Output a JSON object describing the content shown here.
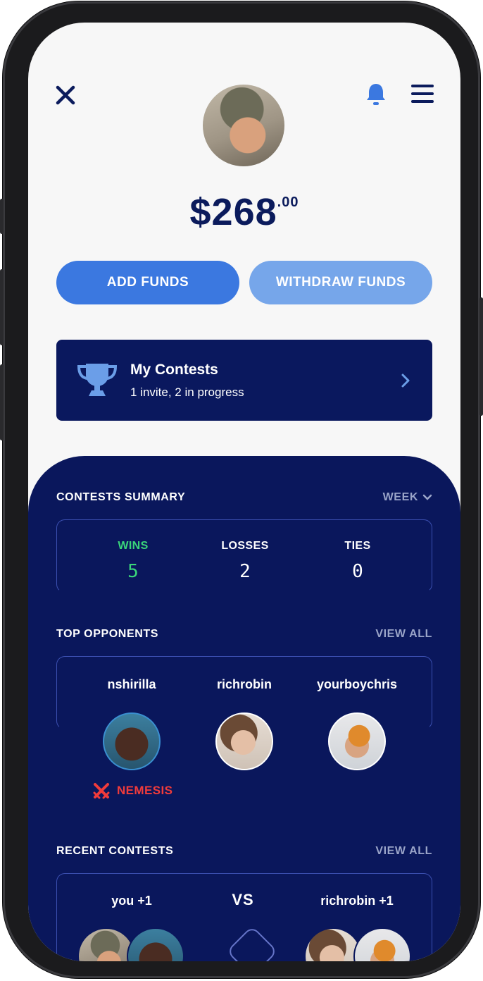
{
  "header": {
    "close_icon": "close-icon",
    "bell_icon": "bell-icon",
    "menu_icon": "hamburger-menu-icon"
  },
  "balance": {
    "dollars": "$268",
    "cents": ".00"
  },
  "actions": {
    "add_funds": "ADD FUNDS",
    "withdraw_funds": "WITHDRAW FUNDS"
  },
  "my_contests": {
    "title": "My Contests",
    "subtitle": "1 invite, 2 in progress",
    "icon": "trophy-icon"
  },
  "contests_summary": {
    "title": "CONTESTS SUMMARY",
    "period": "WEEK",
    "stats": [
      {
        "label": "WINS",
        "value": "5",
        "color": "#3ad67a"
      },
      {
        "label": "LOSSES",
        "value": "2",
        "color": "#ffffff"
      },
      {
        "label": "TIES",
        "value": "0",
        "color": "#ffffff"
      }
    ]
  },
  "top_opponents": {
    "title": "TOP OPPONENTS",
    "view_all": "VIEW ALL",
    "opponents": [
      {
        "name": "nshirilla",
        "badge": "NEMESIS"
      },
      {
        "name": "richrobin"
      },
      {
        "name": "yourboychris"
      }
    ]
  },
  "recent_contests": {
    "title": "RECENT CONTESTS",
    "view_all": "VIEW ALL",
    "left_team": "you +1",
    "versus": "VS",
    "right_team": "richrobin +1"
  },
  "colors": {
    "navy": "#0a175c",
    "primary_blue": "#3b78e0",
    "light_blue": "#76a6ea",
    "win_green": "#3ad67a",
    "nemesis_red": "#f03b3b"
  }
}
